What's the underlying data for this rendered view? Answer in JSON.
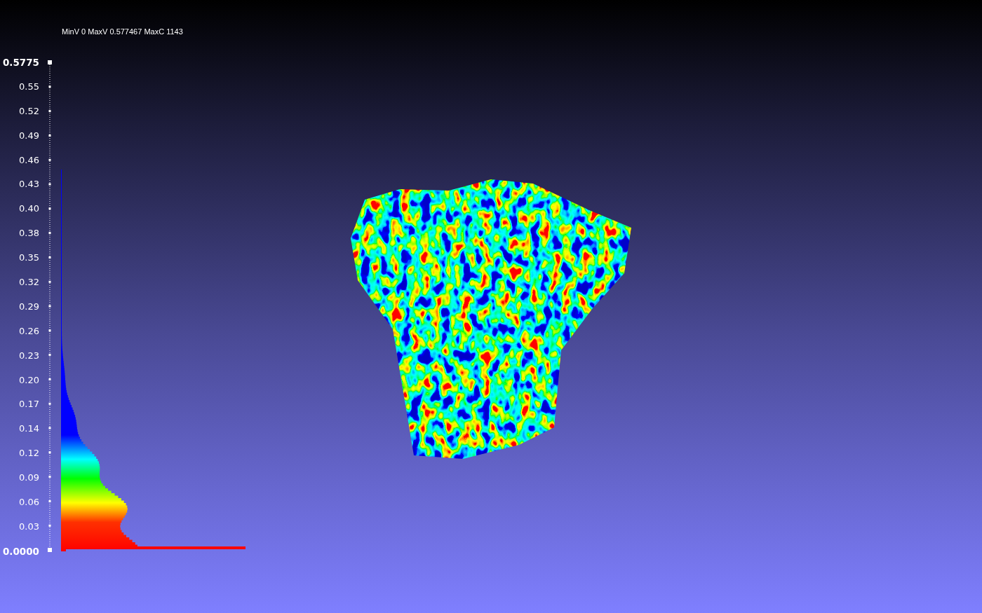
{
  "viewer": {
    "info": "MinV 0 MaxV 0.577467 MaxC 1143",
    "scale_labels": [
      "0.5775",
      "0.55",
      "0.52",
      "0.49",
      "0.46",
      "0.43",
      "0.40",
      "0.38",
      "0.35",
      "0.32",
      "0.29",
      "0.26",
      "0.23",
      "0.20",
      "0.17",
      "0.14",
      "0.12",
      "0.09",
      "0.06",
      "0.03",
      "0.0000"
    ]
  }
}
